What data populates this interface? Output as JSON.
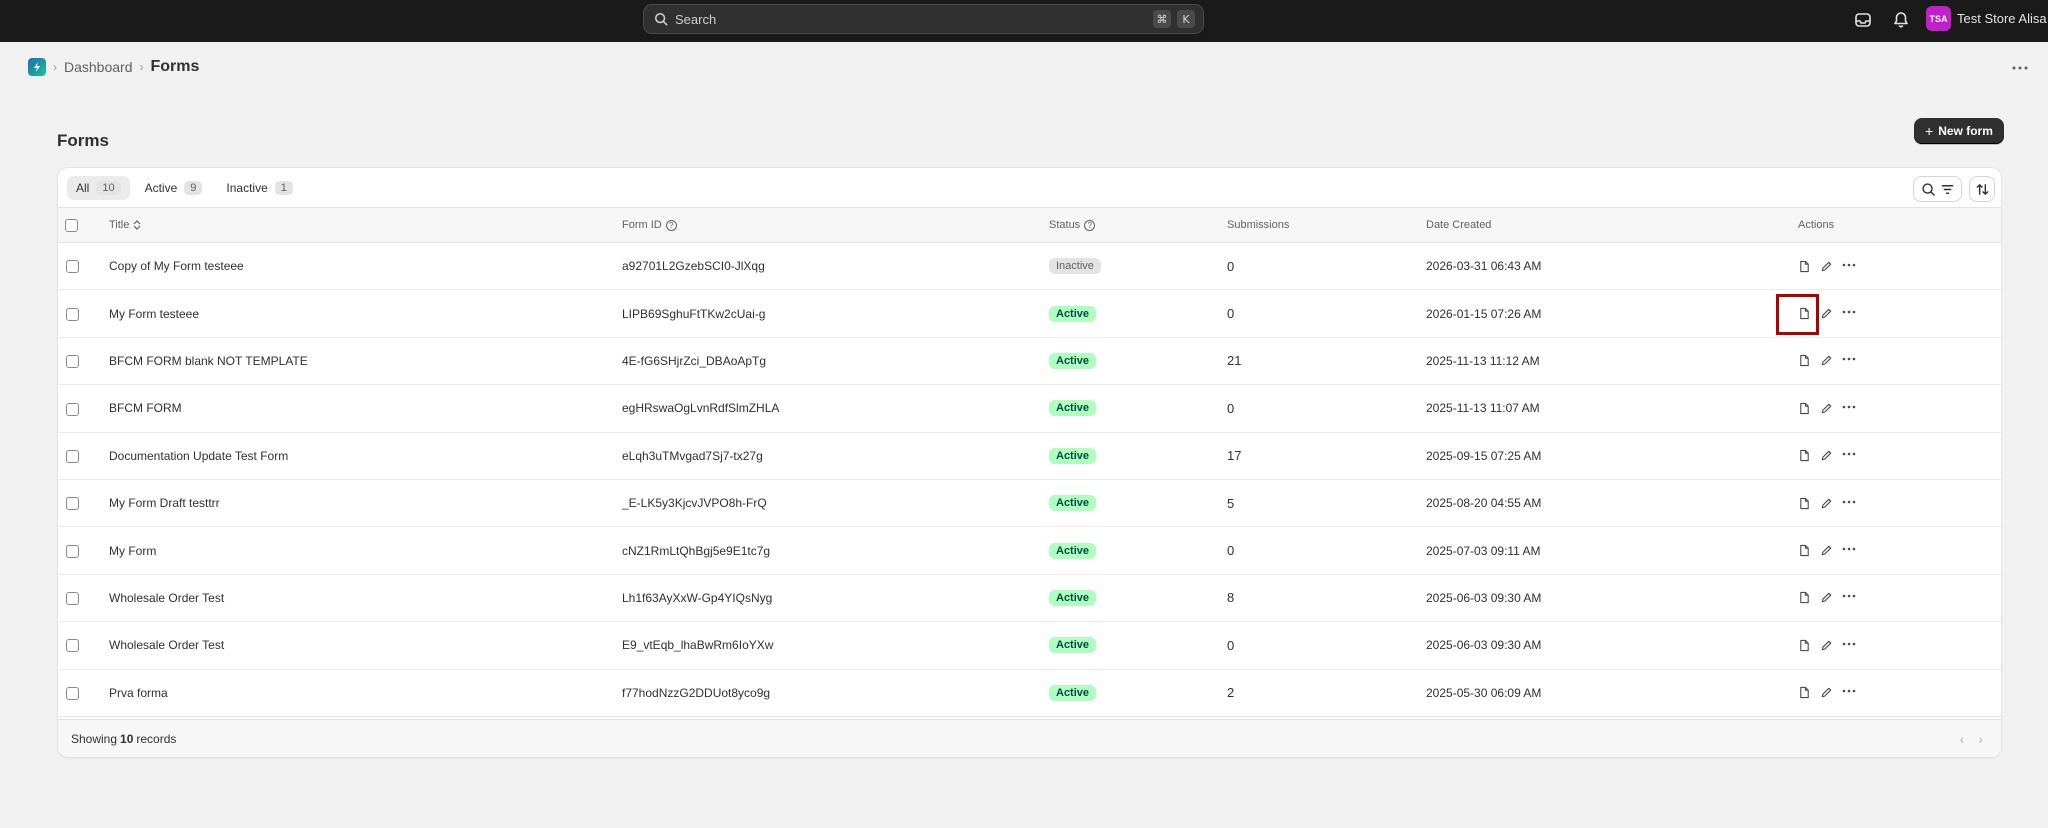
{
  "topbar": {
    "search_placeholder": "Search",
    "shortcut_keys": [
      "⌘",
      "K"
    ],
    "store_initials": "TSA",
    "store_name": "Test Store Alisa"
  },
  "breadcrumb": {
    "dashboard": "Dashboard",
    "current": "Forms"
  },
  "page": {
    "title": "Forms",
    "new_button": "New form"
  },
  "tabs": [
    {
      "label": "All",
      "count": "10",
      "selected": true
    },
    {
      "label": "Active",
      "count": "9",
      "selected": false
    },
    {
      "label": "Inactive",
      "count": "1",
      "selected": false
    }
  ],
  "table": {
    "columns": {
      "title": "Title",
      "form_id": "Form ID",
      "status": "Status",
      "submissions": "Submissions",
      "date_created": "Date Created",
      "actions": "Actions"
    },
    "rows": [
      {
        "title": "Copy of My Form testeee",
        "form_id": "a92701L2GzebSCI0-JlXqg",
        "status": "Inactive",
        "submissions": "0",
        "date": "2026-03-31 06:43 AM"
      },
      {
        "title": "My Form testeee",
        "form_id": "LIPB69SghuFtTKw2cUai-g",
        "status": "Active",
        "submissions": "0",
        "date": "2026-01-15 07:26 AM"
      },
      {
        "title": "BFCM FORM blank NOT TEMPLATE",
        "form_id": "4E-fG6SHjrZci_DBAoApTg",
        "status": "Active",
        "submissions": "21",
        "date": "2025-11-13 11:12 AM"
      },
      {
        "title": "BFCM FORM",
        "form_id": "egHRswaOgLvnRdfSlmZHLA",
        "status": "Active",
        "submissions": "0",
        "date": "2025-11-13 11:07 AM"
      },
      {
        "title": "Documentation Update Test Form",
        "form_id": "eLqh3uTMvgad7Sj7-tx27g",
        "status": "Active",
        "submissions": "17",
        "date": "2025-09-15 07:25 AM"
      },
      {
        "title": "My Form Draft testtrr",
        "form_id": "_E-LK5y3KjcvJVPO8h-FrQ",
        "status": "Active",
        "submissions": "5",
        "date": "2025-08-20 04:55 AM"
      },
      {
        "title": "My Form",
        "form_id": "cNZ1RmLtQhBgj5e9E1tc7g",
        "status": "Active",
        "submissions": "0",
        "date": "2025-07-03 09:11 AM"
      },
      {
        "title": "Wholesale Order Test",
        "form_id": "Lh1f63AyXxW-Gp4YIQsNyg",
        "status": "Active",
        "submissions": "8",
        "date": "2025-06-03 09:30 AM"
      },
      {
        "title": "Wholesale Order Test",
        "form_id": "E9_vtEqb_lhaBwRm6IoYXw",
        "status": "Active",
        "submissions": "0",
        "date": "2025-06-03 09:30 AM"
      },
      {
        "title": "Prva forma",
        "form_id": "f77hodNzzG2DDUot8yco9g",
        "status": "Active",
        "submissions": "2",
        "date": "2025-05-30 06:09 AM"
      }
    ]
  },
  "footer": {
    "prefix": "Showing",
    "count": "10",
    "suffix": "records"
  },
  "icons": {
    "search": "search-icon",
    "row_view": "document-icon",
    "row_edit": "pencil-icon",
    "row_more": "more-horizontal-icon"
  },
  "colors": {
    "active_badge_bg": "#affebf",
    "active_badge_text": "#014b40",
    "avatar_bg": "#c21ec9",
    "highlight_border": "#b00000"
  }
}
